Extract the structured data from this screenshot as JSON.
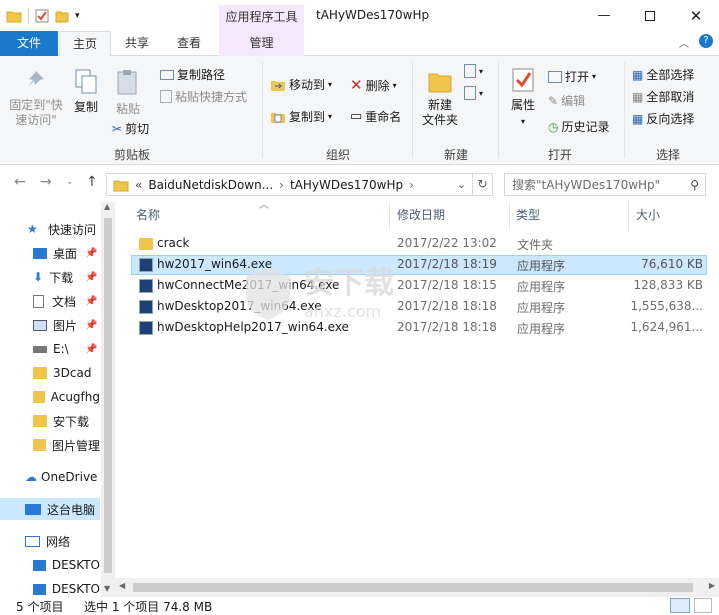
{
  "window": {
    "title": "tAHyWDes170wHp",
    "context_tab_group": "应用程序工具"
  },
  "tabs": {
    "file": "文件",
    "home": "主页",
    "share": "共享",
    "view": "查看",
    "manage": "管理"
  },
  "ribbon": {
    "clipboard": {
      "pin": "固定到\"快\n速访问\"",
      "copy": "复制",
      "paste": "粘贴",
      "copy_path": "复制路径",
      "paste_shortcut": "粘贴快捷方式",
      "cut": "剪切",
      "label": "剪贴板"
    },
    "organize": {
      "move_to": "移动到",
      "delete": "删除",
      "copy_to": "复制到",
      "rename": "重命名",
      "label": "组织"
    },
    "new": {
      "new_folder": "新建\n文件夹",
      "label": "新建"
    },
    "open": {
      "properties": "属性",
      "open": "打开",
      "edit": "编辑",
      "history": "历史记录",
      "label": "打开"
    },
    "select": {
      "select_all": "全部选择",
      "select_none": "全部取消",
      "invert": "反向选择",
      "label": "选择"
    }
  },
  "address": {
    "path_prefix": "«",
    "crumb1": "BaiduNetdiskDown...",
    "crumb2": "tAHyWDes170wHp",
    "search_placeholder": "搜索\"tAHyWDes170wHp\""
  },
  "nav": {
    "quick_access": "快速访问",
    "items": [
      "桌面",
      "下载",
      "文档",
      "图片",
      "E:\\",
      "3Dcad",
      "Acugfhg",
      "安下载",
      "图片管理"
    ],
    "onedrive": "OneDrive",
    "this_pc": "这台电脑",
    "network": "网络",
    "desktop1": "DESKTO",
    "desktop2": "DESKTO"
  },
  "columns": {
    "name": "名称",
    "date": "修改日期",
    "type": "类型",
    "size": "大小"
  },
  "files": [
    {
      "name": "crack",
      "date": "2017/2/22 13:02",
      "type": "文件夹",
      "size": ""
    },
    {
      "name": "hw2017_win64.exe",
      "date": "2017/2/18 18:19",
      "type": "应用程序",
      "size": "76,610 KB"
    },
    {
      "name": "hwConnectMe2017_win64.exe",
      "date": "2017/2/18 18:15",
      "type": "应用程序",
      "size": "128,833 KB"
    },
    {
      "name": "hwDesktop2017_win64.exe",
      "date": "2017/2/18 18:18",
      "type": "应用程序",
      "size": "1,555,638..."
    },
    {
      "name": "hwDesktopHelp2017_win64.exe",
      "date": "2017/2/18 18:18",
      "type": "应用程序",
      "size": "1,624,961..."
    }
  ],
  "status": {
    "count": "5 个项目",
    "selection": "选中 1 个项目 74.8 MB"
  },
  "watermark": {
    "text": "安下载",
    "sub": "anxz.com"
  }
}
